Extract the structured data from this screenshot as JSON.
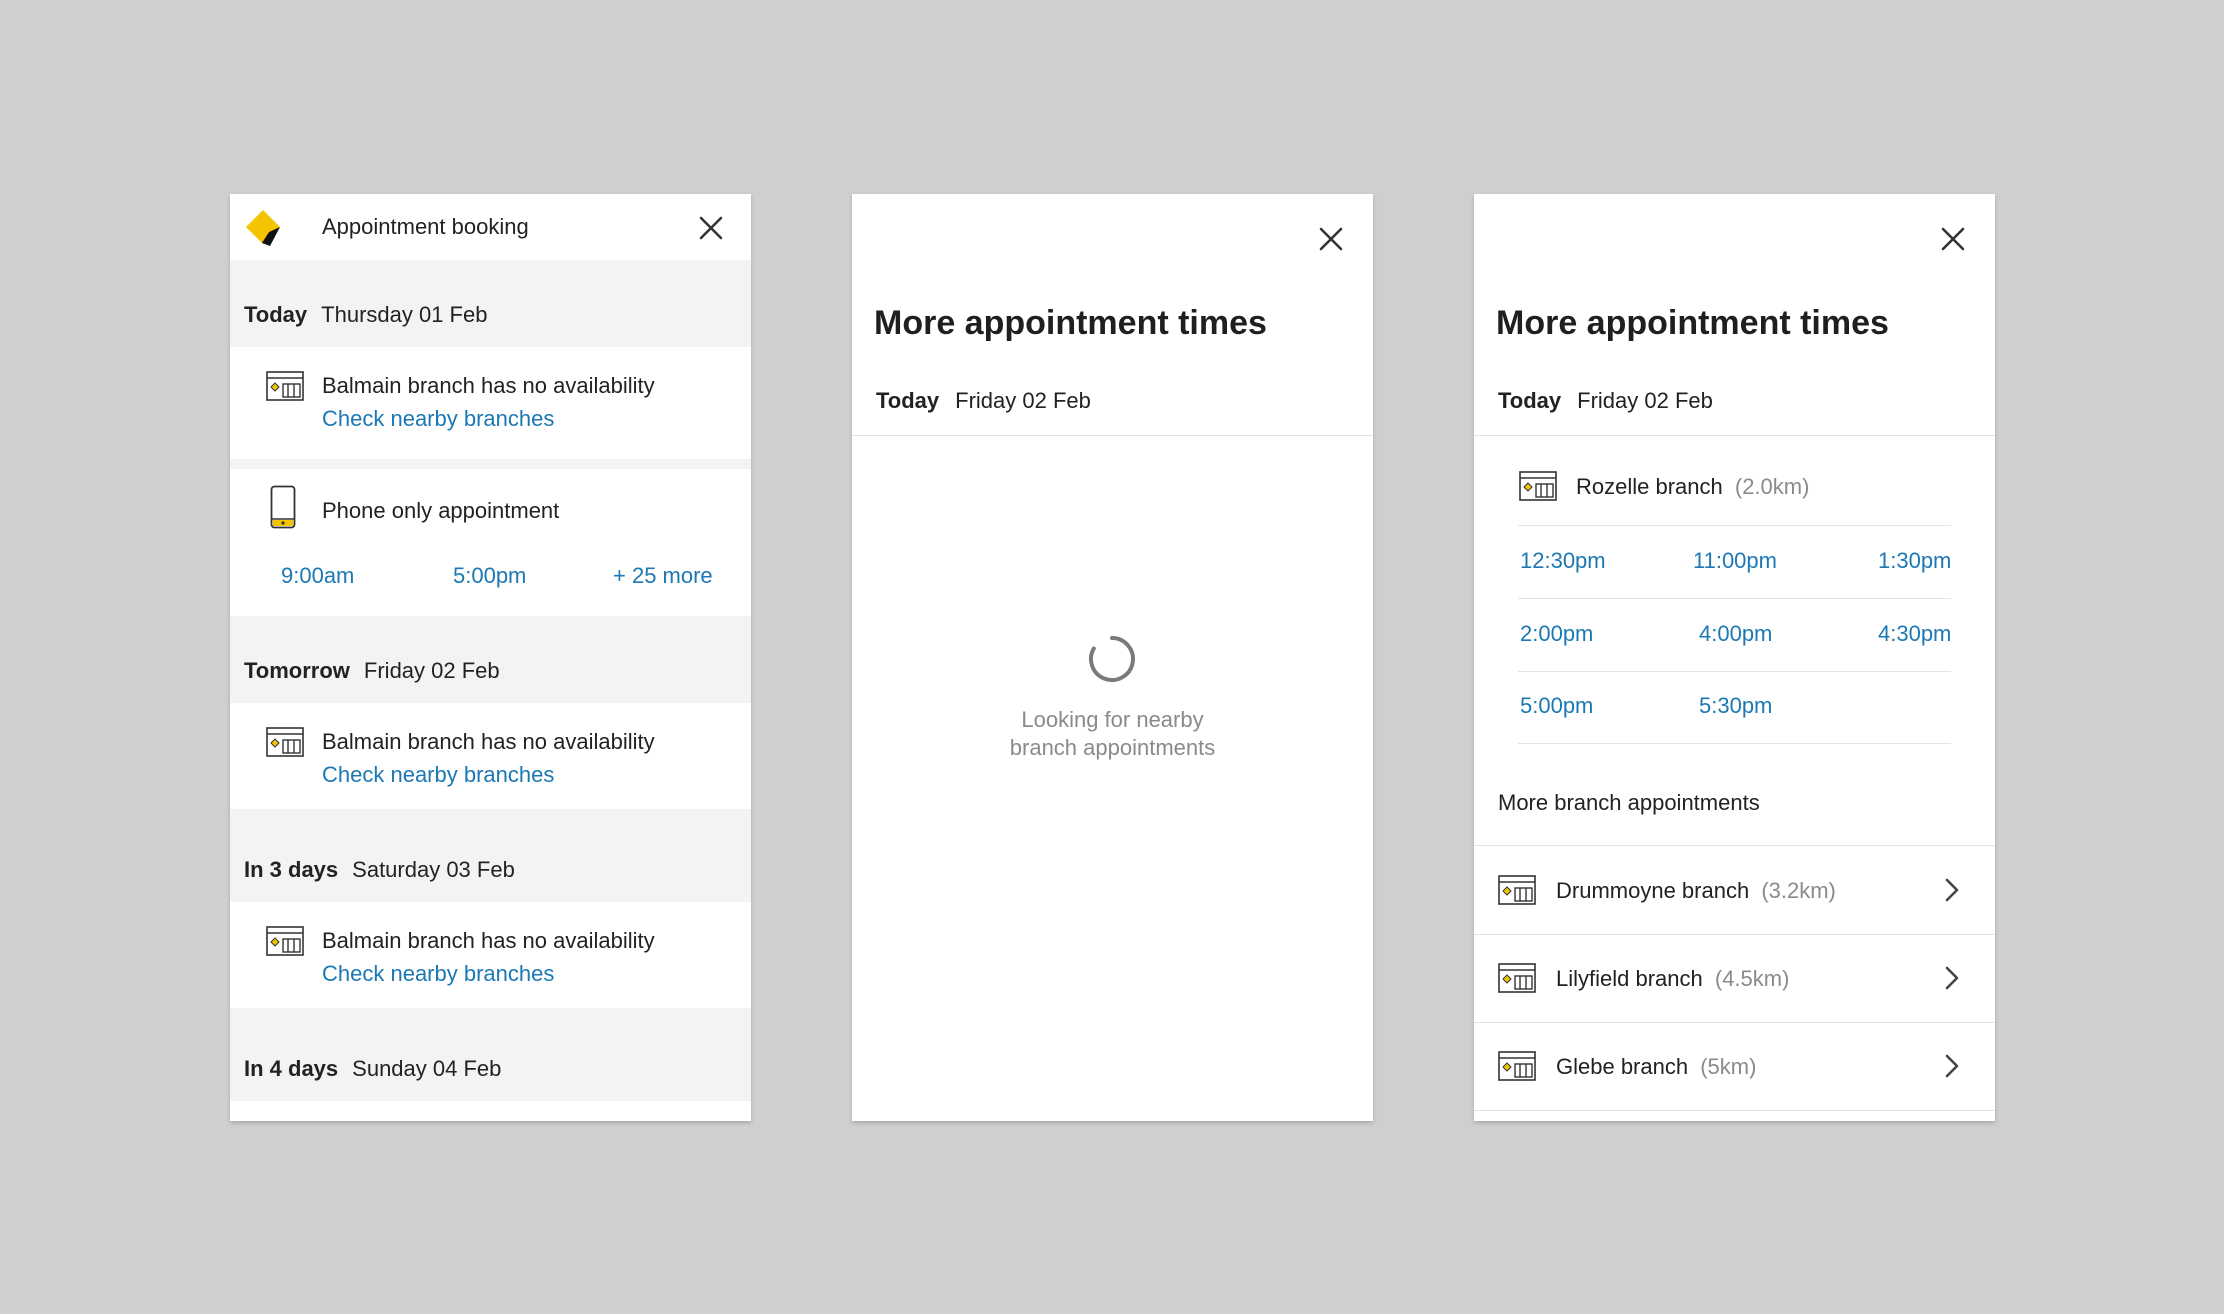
{
  "colors": {
    "background": "#cfcfcf",
    "link": "#1c78b4",
    "muted": "#8a8a8a",
    "brand_yellow": "#f5c400"
  },
  "panel1": {
    "title": "Appointment booking",
    "icons": {
      "logo": "brand-diamond-logo",
      "close": "close-icon"
    },
    "days": [
      {
        "label": "Today",
        "date": "Thursday 01 Feb",
        "branch_text": "Balmain branch has no availability",
        "link": "Check nearby branches"
      },
      {
        "label": "Tomorrow",
        "date": "Friday 02 Feb",
        "branch_text": "Balmain branch has no availability",
        "link": "Check nearby branches"
      },
      {
        "label": "In 3 days",
        "date": "Saturday 03 Feb",
        "branch_text": "Balmain branch has no availability",
        "link": "Check nearby branches"
      },
      {
        "label": "In 4 days",
        "date": "Sunday 04 Feb"
      }
    ],
    "phone": {
      "text": "Phone only appointment",
      "times": [
        "9:00am",
        "5:00pm",
        "+ 25 more"
      ]
    }
  },
  "panel2": {
    "title": "More appointment times",
    "today_label": "Today",
    "today_date": "Friday 02 Feb",
    "loading_line1": "Looking for nearby",
    "loading_line2": "branch appointments"
  },
  "panel3": {
    "title": "More appointment times",
    "today_label": "Today",
    "today_date": "Friday 02 Feb",
    "selected_branch": {
      "name": "Rozelle branch",
      "distance": "(2.0km)"
    },
    "slots": [
      "12:30pm",
      "11:00pm",
      "1:30pm",
      "2:00pm",
      "4:00pm",
      "4:30pm",
      "5:00pm",
      "5:30pm"
    ],
    "more_label": "More branch appointments",
    "branches": [
      {
        "name": "Drummoyne branch",
        "distance": "(3.2km)"
      },
      {
        "name": "Lilyfield branch",
        "distance": "(4.5km)"
      },
      {
        "name": "Glebe branch",
        "distance": "(5km)"
      }
    ]
  }
}
